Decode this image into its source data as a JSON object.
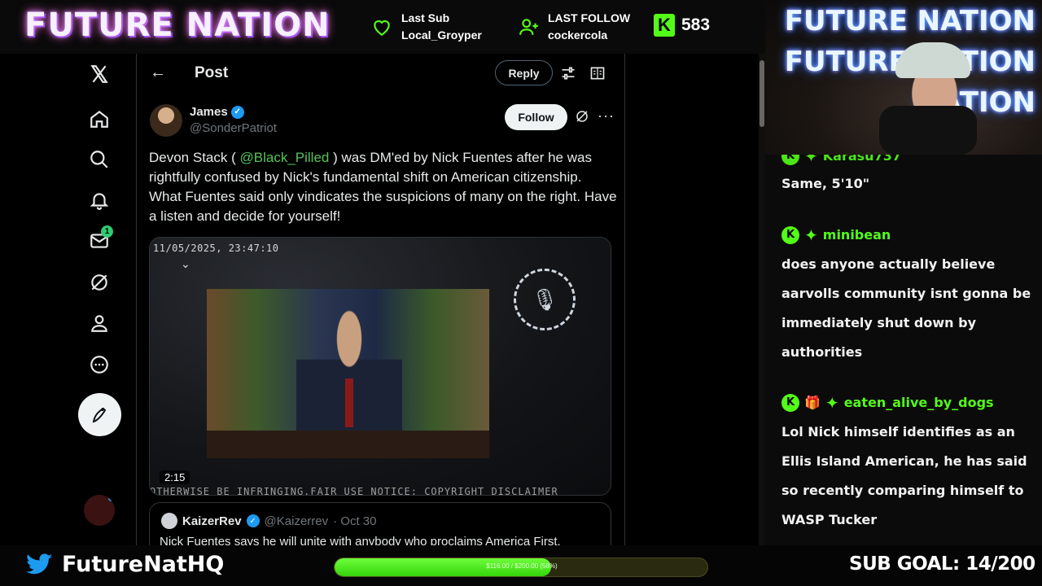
{
  "overlay": {
    "brand": "FUTURE NATION",
    "last_sub_label": "Last Sub",
    "last_sub_value": "Local_Groyper",
    "last_follow_label": "LAST FOLLOW",
    "last_follow_value": "cockercola",
    "kick_logo": "K",
    "viewer_count": "583",
    "cam_logo_lines": [
      "FUTURE NATION",
      "FUTURE NATION",
      "NATION"
    ],
    "twitter_handle": "FutureNatHQ",
    "goal_bar_text": "$116.00 / $200.00 (58%)",
    "goal_progress": 0.58,
    "sub_goal": "SUB GOAL: 14/200"
  },
  "rail": {
    "notification_badge": "1",
    "icons": [
      "x-logo-icon",
      "home-icon",
      "search-icon",
      "bell-icon",
      "mail-icon",
      "grok-icon",
      "profile-icon",
      "more-icon",
      "post-compose-icon"
    ]
  },
  "post_header": {
    "back": "←",
    "title": "Post",
    "reply_label": "Reply"
  },
  "tweet": {
    "author_name": "James",
    "author_handle": "@SonderPatriot",
    "follow_label": "Follow",
    "more": "···",
    "text_before": "Devon Stack ( ",
    "mention": "@Black_Pilled",
    "text_after": " ) was DM'ed by Nick Fuentes after he was rightfully confused by Nick's fundamental shift on American citizenship. What Fuentes said only vindicates the suspicions of many on the right. Have a listen and decide for yourself!",
    "media": {
      "timestamp": "11/05/2025, 23:47:10",
      "duration": "2:15",
      "ticker": "OTHERWISE BE INFRINGING.FAIR USE NOTICE: COPYRIGHT DISCLAIMER"
    },
    "quote": {
      "name": "KaizerRev",
      "handle": "@Kaizerrev",
      "date": "· Oct 30",
      "text": "Nick Fuentes says he will unite with anybody who proclaims America First."
    }
  },
  "chat": {
    "messages": [
      {
        "user": "Karasu737",
        "text": "Same, 5'10\""
      },
      {
        "user": "minibean",
        "text": "does anyone actually believe aarvolls community isnt gonna be immediately shut down by authorities"
      },
      {
        "user": "eaten_alive_by_dogs",
        "text": "Lol Nick himself identifies as an Ellis Island American, he has said so recently comparing himself to WASP Tucker"
      }
    ]
  },
  "colors": {
    "kick_green": "#53fc18",
    "x_blue": "#1d9bf0",
    "background": "#000000"
  }
}
